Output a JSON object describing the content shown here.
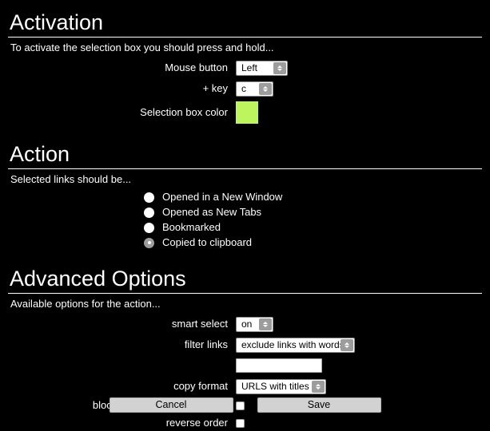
{
  "sections": {
    "activation": {
      "title": "Activation",
      "subtitle": "To activate the selection box you should press and hold...",
      "fields": {
        "mouse_button": {
          "label": "Mouse button",
          "value": "Left"
        },
        "key": {
          "label": "+ key",
          "value": "c"
        },
        "selection_box_color": {
          "label": "Selection box color",
          "value": "#bdf55e"
        }
      }
    },
    "action": {
      "title": "Action",
      "subtitle": "Selected links should be...",
      "options": [
        {
          "label": "Opened in a New Window",
          "selected": false
        },
        {
          "label": "Opened as New Tabs",
          "selected": false
        },
        {
          "label": "Bookmarked",
          "selected": false
        },
        {
          "label": "Copied to clipboard",
          "selected": true
        }
      ]
    },
    "advanced": {
      "title": "Advanced Options",
      "subtitle": "Available options for the action...",
      "fields": {
        "smart_select": {
          "label": "smart select",
          "value": "on"
        },
        "filter_links": {
          "label": "filter links",
          "value": "exclude links with words"
        },
        "filter_words": {
          "label": "",
          "value": "",
          "placeholder": ""
        },
        "copy_format": {
          "label": "copy format",
          "value": "URLS with titles"
        },
        "block_repeat": {
          "label": "block repeat links in selection",
          "checked": false
        },
        "reverse_order": {
          "label": "reverse order",
          "checked": false
        }
      }
    }
  },
  "footer": {
    "cancel_label": "Cancel",
    "save_label": "Save"
  }
}
